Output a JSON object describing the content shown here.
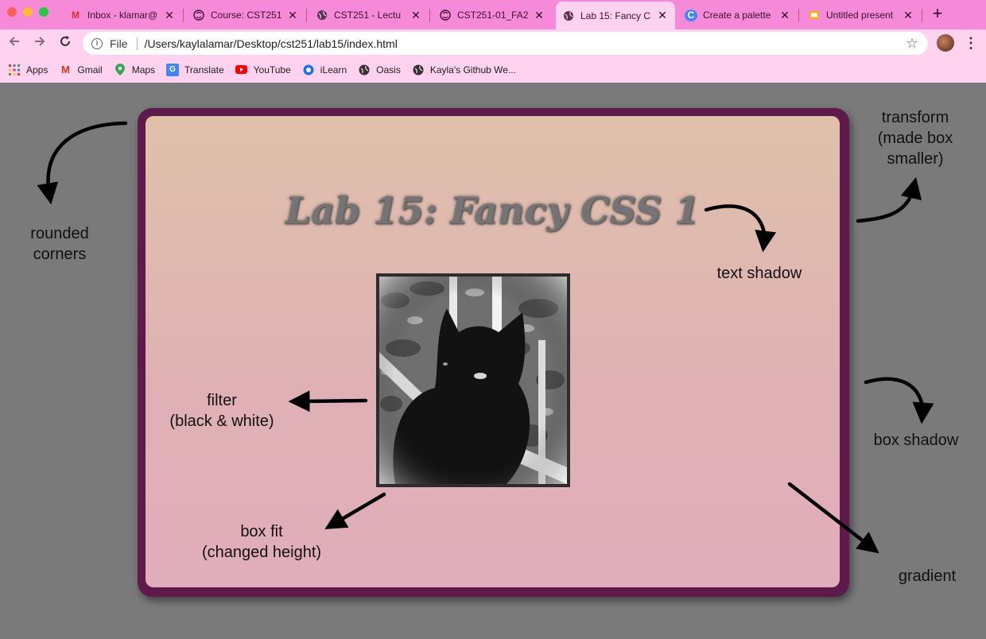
{
  "browser": {
    "tabs": [
      {
        "icon": "gmail-icon",
        "title": "Inbox - klamar@"
      },
      {
        "icon": "ilearn-brain-icon",
        "title": "Course: CST251"
      },
      {
        "icon": "globe-icon",
        "title": "CST251 - Lectu"
      },
      {
        "icon": "ilearn-brain-icon",
        "title": "CST251-01_FA2"
      },
      {
        "icon": "globe-icon",
        "title": "Lab 15: Fancy C",
        "active": true
      },
      {
        "icon": "google-c-icon",
        "title": "Create a palette"
      },
      {
        "icon": "slides-icon",
        "title": "Untitled present"
      }
    ],
    "address": {
      "scheme_label": "File",
      "url": "/Users/kaylalamar/Desktop/cst251/lab15/index.html"
    },
    "bookmarks": [
      {
        "icon": "apps-grid-icon",
        "label": "Apps"
      },
      {
        "icon": "gmail-icon",
        "label": "Gmail"
      },
      {
        "icon": "maps-pin-icon",
        "label": "Maps"
      },
      {
        "icon": "translate-icon",
        "label": "Translate"
      },
      {
        "icon": "youtube-icon",
        "label": "YouTube"
      },
      {
        "icon": "ilearn-icon",
        "label": "iLearn"
      },
      {
        "icon": "globe-icon",
        "label": "Oasis"
      },
      {
        "icon": "globe-icon",
        "label": "Kayla's Github We..."
      }
    ]
  },
  "page": {
    "heading": "Lab 15: Fancy CSS 1",
    "image_alt": "black and white photo of a black cat",
    "annotations": {
      "rounded_corners": [
        "rounded",
        "corners"
      ],
      "transform": [
        "transform",
        "(made box",
        "smaller)"
      ],
      "text_shadow": "text shadow",
      "filter": [
        "filter",
        "(black & white)"
      ],
      "box_shadow": "box shadow",
      "box_fit": [
        "box fit",
        "(changed height)"
      ],
      "gradient": "gradient"
    }
  },
  "colors": {
    "tabstrip": "#f78ad8",
    "toolbar": "#ffd2ef",
    "page_background": "#7a7a7a",
    "box_border": "#5d1a4a",
    "gradient_top": "#dfc1aa",
    "gradient_bottom": "#e0adbb"
  }
}
